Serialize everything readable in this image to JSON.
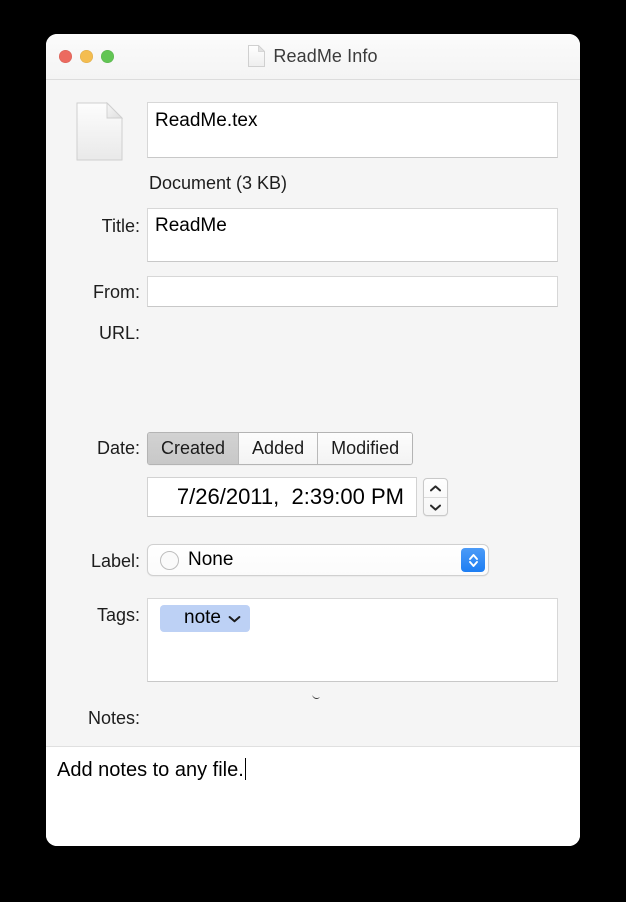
{
  "window": {
    "title": "ReadMe Info",
    "title_icon": "document-icon",
    "traffic_lights": {
      "close": "close-button",
      "minimize": "minimize-button",
      "zoom": "zoom-button"
    }
  },
  "file": {
    "icon": "document-icon",
    "name_value": "ReadMe.tex",
    "name_placeholder": "Name",
    "kind_and_size": "Document (3 KB)"
  },
  "fields": {
    "title_label": "Title:",
    "title_value": "ReadMe",
    "title_placeholder": "",
    "from_label": "From:",
    "from_value": "",
    "from_placeholder": "",
    "url_label": "URL:"
  },
  "date": {
    "label": "Date:",
    "segments": [
      {
        "label": "Created",
        "selected": true
      },
      {
        "label": "Added",
        "selected": false
      },
      {
        "label": "Modified",
        "selected": false
      }
    ],
    "value": "7/26/2011,  2:39:00 PM",
    "stepper_up_icon": "chevron-up-icon",
    "stepper_down_icon": "chevron-down-icon"
  },
  "label_control": {
    "label": "Label:",
    "selected_option": "None",
    "swatch_icon": "empty-circle-icon",
    "arrow_icon": "chevron-up-down-icon",
    "options": [
      "None"
    ],
    "accent_color": "#1d7ef3"
  },
  "tags": {
    "label": "Tags:",
    "tokens": [
      {
        "text": "note",
        "color": "#bdd1f5",
        "chevron_icon": "chevron-down-icon"
      }
    ],
    "placeholder": ""
  },
  "notes": {
    "label": "Notes:",
    "value": "Add notes to any file."
  }
}
